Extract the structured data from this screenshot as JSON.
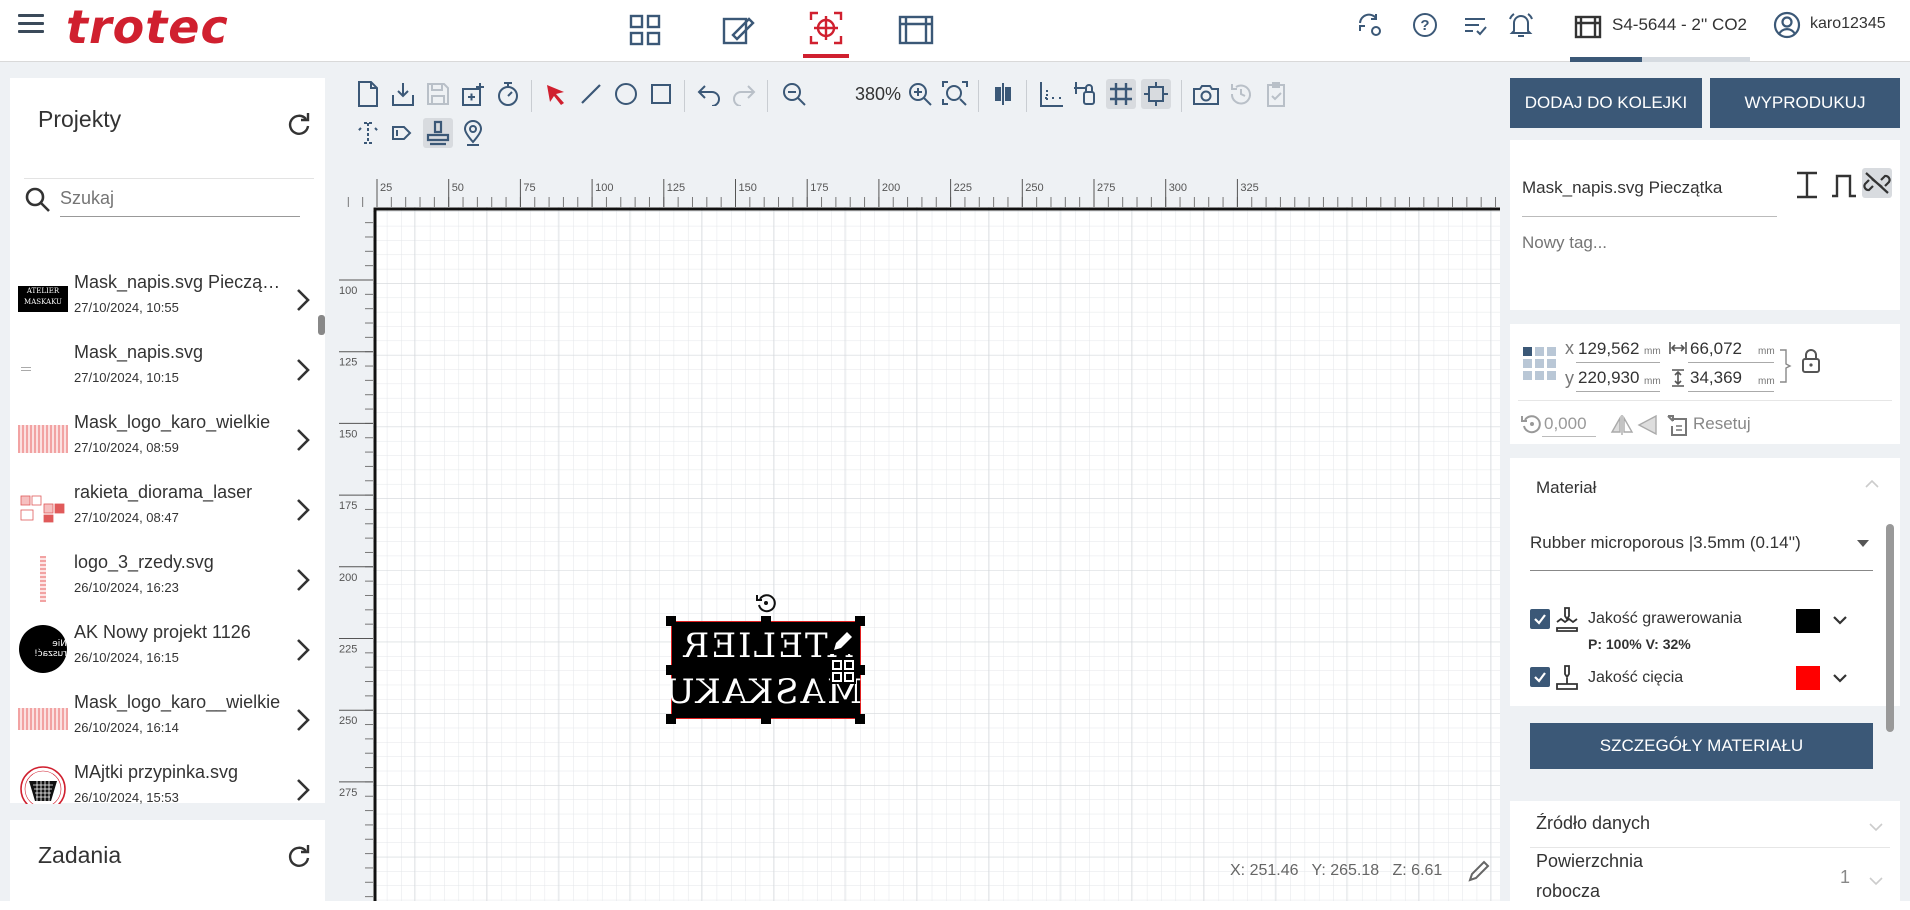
{
  "header": {
    "brand": "trotec",
    "machine": "S4-5644 - 2'' CO2",
    "user": "karo12345"
  },
  "projects": {
    "title": "Projekty",
    "search_placeholder": "Szukaj",
    "items": [
      {
        "name": "Mask_napis.svg Pieczątka",
        "date": "27/10/2024, 10:55"
      },
      {
        "name": "Mask_napis.svg",
        "date": "27/10/2024, 10:15"
      },
      {
        "name": "Mask_logo_karo_wielkie",
        "date": "27/10/2024, 08:59"
      },
      {
        "name": "rakieta_diorama_laser",
        "date": "27/10/2024, 08:47"
      },
      {
        "name": "logo_3_rzedy.svg",
        "date": "26/10/2024, 16:23"
      },
      {
        "name": "AK Nowy projekt 1126",
        "date": "26/10/2024, 16:15"
      },
      {
        "name": "Mask_logo_karo__wielkie",
        "date": "26/10/2024, 16:14"
      },
      {
        "name": "MAjtki przypinka.svg",
        "date": "26/10/2024, 15:53"
      }
    ]
  },
  "tasks": {
    "title": "Zadania"
  },
  "toolbar": {
    "zoom": "380%"
  },
  "ruler": {
    "x_ticks": [
      "25",
      "50",
      "75",
      "100",
      "125",
      "150",
      "175",
      "200",
      "225",
      "250",
      "275",
      "300",
      "325"
    ],
    "y_ticks": [
      "100",
      "125",
      "150",
      "175",
      "200",
      "225",
      "250",
      "275"
    ]
  },
  "canvas": {
    "line1": "ATELIER",
    "line2": "MASKAKU"
  },
  "status": {
    "x": "X: 251.46",
    "y": "Y: 265.18",
    "z": "Z: 6.61"
  },
  "actions": {
    "queue": "DODAJ DO KOLEJKI",
    "produce": "WYPRODUKUJ"
  },
  "job": {
    "name": "Mask_napis.svg Pieczątka",
    "tag_placeholder": "Nowy tag..."
  },
  "position": {
    "x_label": "x",
    "y_label": "y",
    "x": "129,562",
    "y": "220,930",
    "width": "66,072",
    "height": "34,369",
    "unit": "mm",
    "rotation": "0,000",
    "reset": "Resetuj"
  },
  "material": {
    "title": "Materiał",
    "selected": "Rubber microporous |3.5mm (0.14'')",
    "engrave_label": "Jakość grawerowania",
    "engrave_color": "#000000",
    "engrave_params": "P: 100%  V: 32%",
    "cut_label": "Jakość cięcia",
    "cut_color": "#ff0000",
    "details_button": "SZCZEGÓŁY MATERIAŁU"
  },
  "data_source": {
    "title": "Źródło danych",
    "work_surface_label_1": "Powierzchnia",
    "work_surface_label_2": "robocza",
    "work_surface_value": "1"
  },
  "colors": {
    "accent": "#d0202f",
    "primary": "#3b5877",
    "panel_bg": "#eef1f4"
  }
}
